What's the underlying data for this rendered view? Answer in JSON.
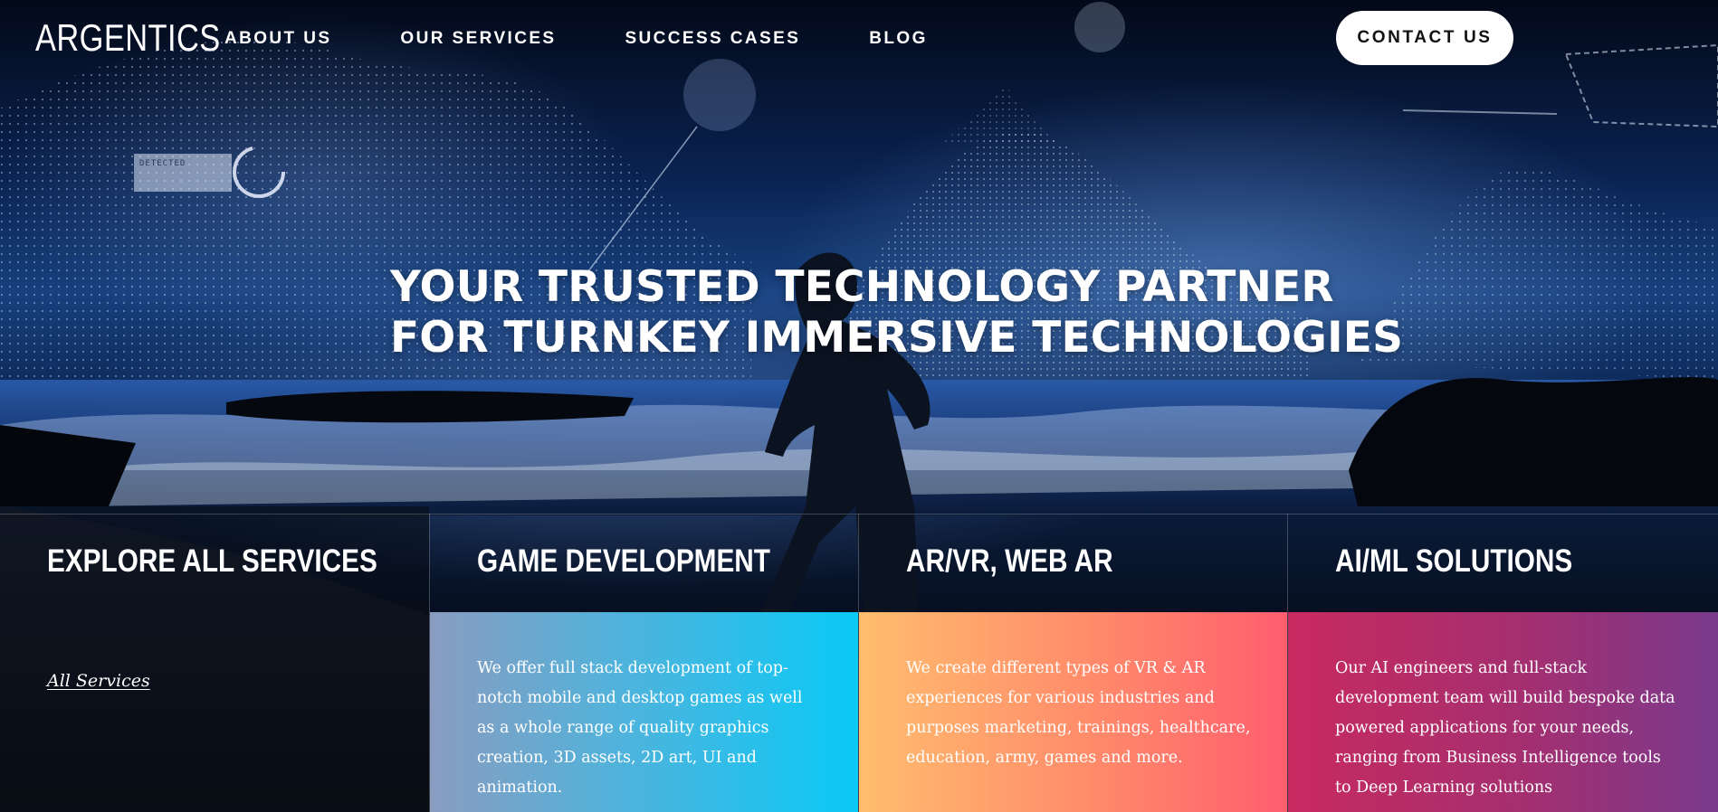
{
  "brand": {
    "logo": "ARGENTICS"
  },
  "nav": {
    "items": [
      {
        "label": "ABOUT US"
      },
      {
        "label": "OUR SERVICES"
      },
      {
        "label": "SUCCESS CASES"
      },
      {
        "label": "BLOG"
      }
    ],
    "contact_label": "CONTACT US"
  },
  "hero": {
    "headline_line1": "YOUR TRUSTED TECHNOLOGY PARTNER",
    "headline_line2": "FOR TURNKEY IMMERSIVE TECHNOLOGIES",
    "hud_label": "DETECTED"
  },
  "services": {
    "explore": {
      "title": "EXPLORE ALL SERVICES",
      "link_label": "All Services"
    },
    "items": [
      {
        "title": "GAME DEVELOPMENT",
        "description": "We offer full stack development of top-notch mobile and desktop games as well as a whole range of quality graphics creation, 3D assets, 2D art, UI and animation."
      },
      {
        "title": "AR/VR, WEB AR",
        "description": "We create different types of VR & AR experiences for various industries and purposes marketing, trainings, healthcare, education, army, games and more."
      },
      {
        "title": "AI/ML SOLUTIONS",
        "description": "Our AI engineers and full-stack development team will build bespoke data powered applications for your needs, ranging from Business Intelligence tools to Deep Learning solutions"
      }
    ]
  },
  "colors": {
    "game_gradient": [
      "#8a9cc0",
      "#0ac9f6"
    ],
    "arvr_gradient": [
      "#ffbd6e",
      "#ff5e6e"
    ],
    "ai_gradient": [
      "#c82a5f",
      "#7a3a8c"
    ]
  }
}
